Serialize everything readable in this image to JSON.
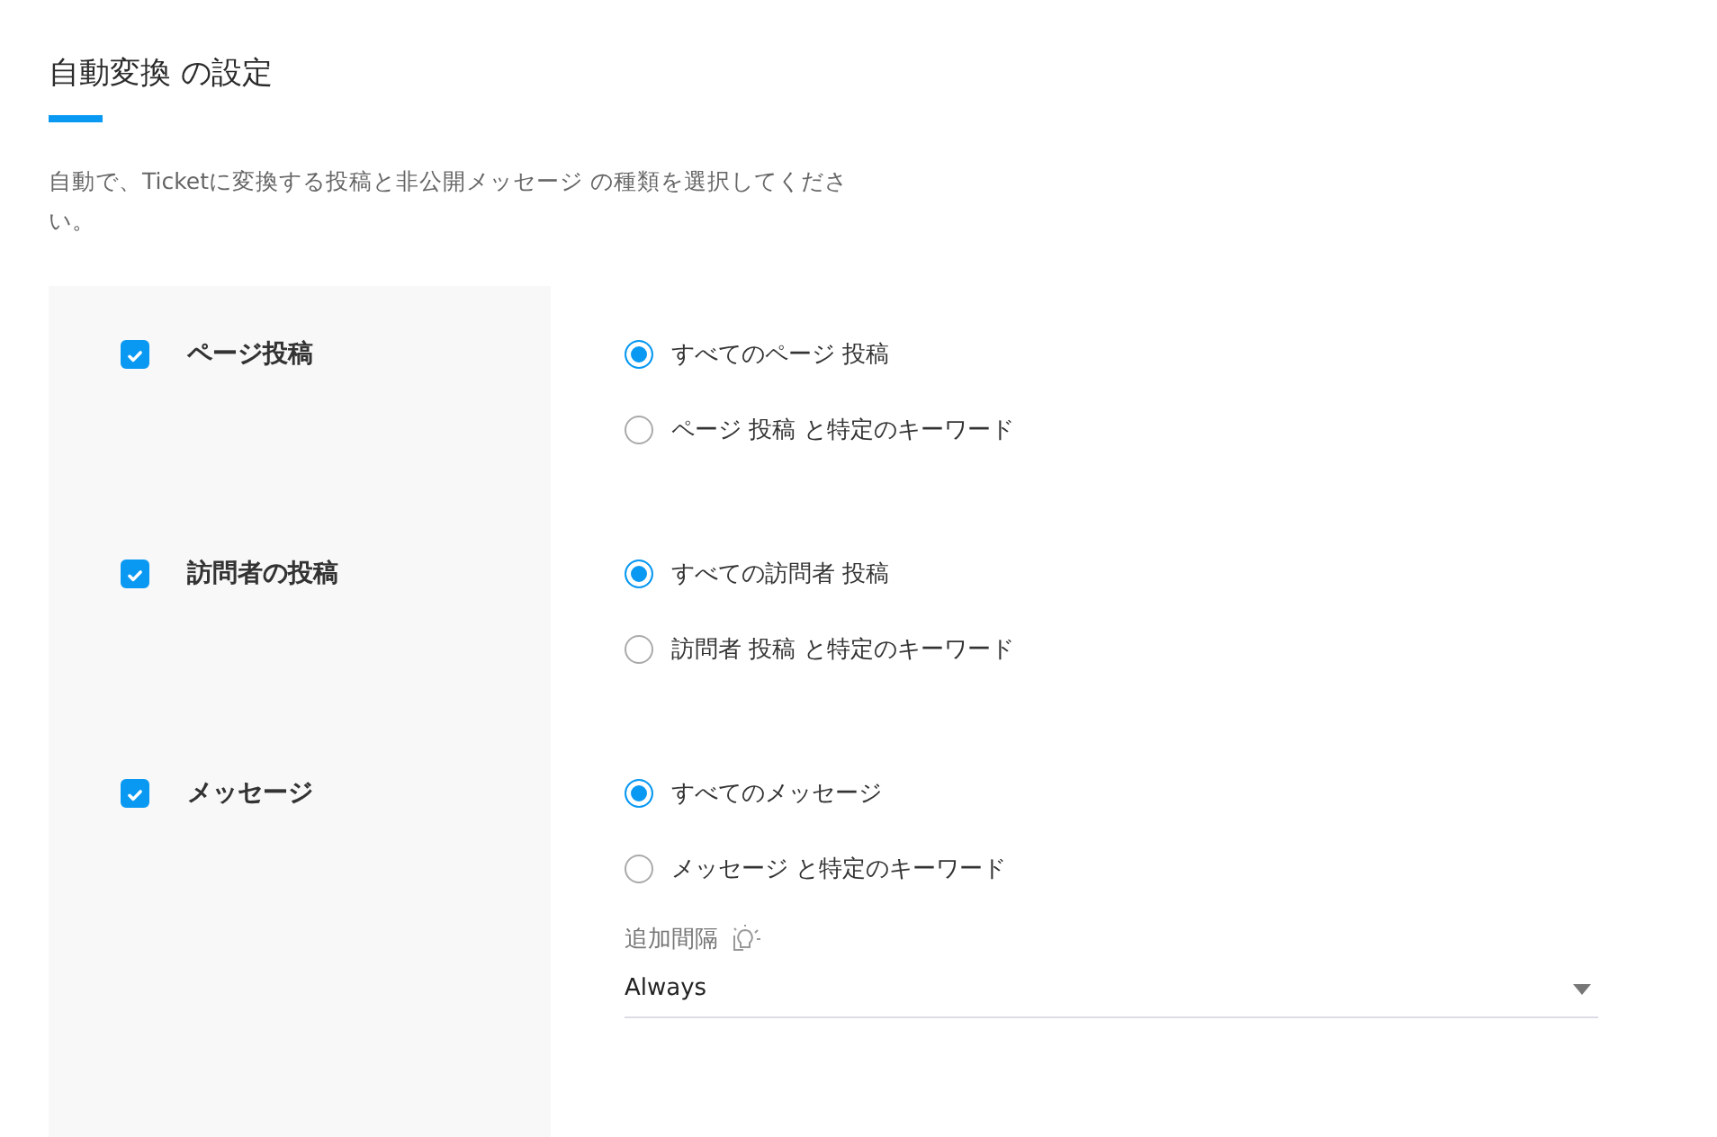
{
  "title": "自動変換 の設定",
  "description": "自動で、Ticketに変換する投稿と非公開メッセージ の種類を選択してください。",
  "sections": [
    {
      "label": "ページ投稿",
      "checked": true,
      "options": [
        {
          "label": "すべてのページ 投稿",
          "selected": true
        },
        {
          "label": "ページ 投稿 と特定のキーワード",
          "selected": false
        }
      ]
    },
    {
      "label": "訪問者の投稿",
      "checked": true,
      "options": [
        {
          "label": "すべての訪問者 投稿",
          "selected": true
        },
        {
          "label": "訪問者 投稿 と特定のキーワード",
          "selected": false
        }
      ]
    },
    {
      "label": "メッセージ",
      "checked": true,
      "options": [
        {
          "label": "すべてのメッセージ",
          "selected": true
        },
        {
          "label": "メッセージ と特定のキーワード",
          "selected": false
        }
      ],
      "interval": {
        "label": "追加間隔",
        "value": "Always"
      }
    }
  ]
}
